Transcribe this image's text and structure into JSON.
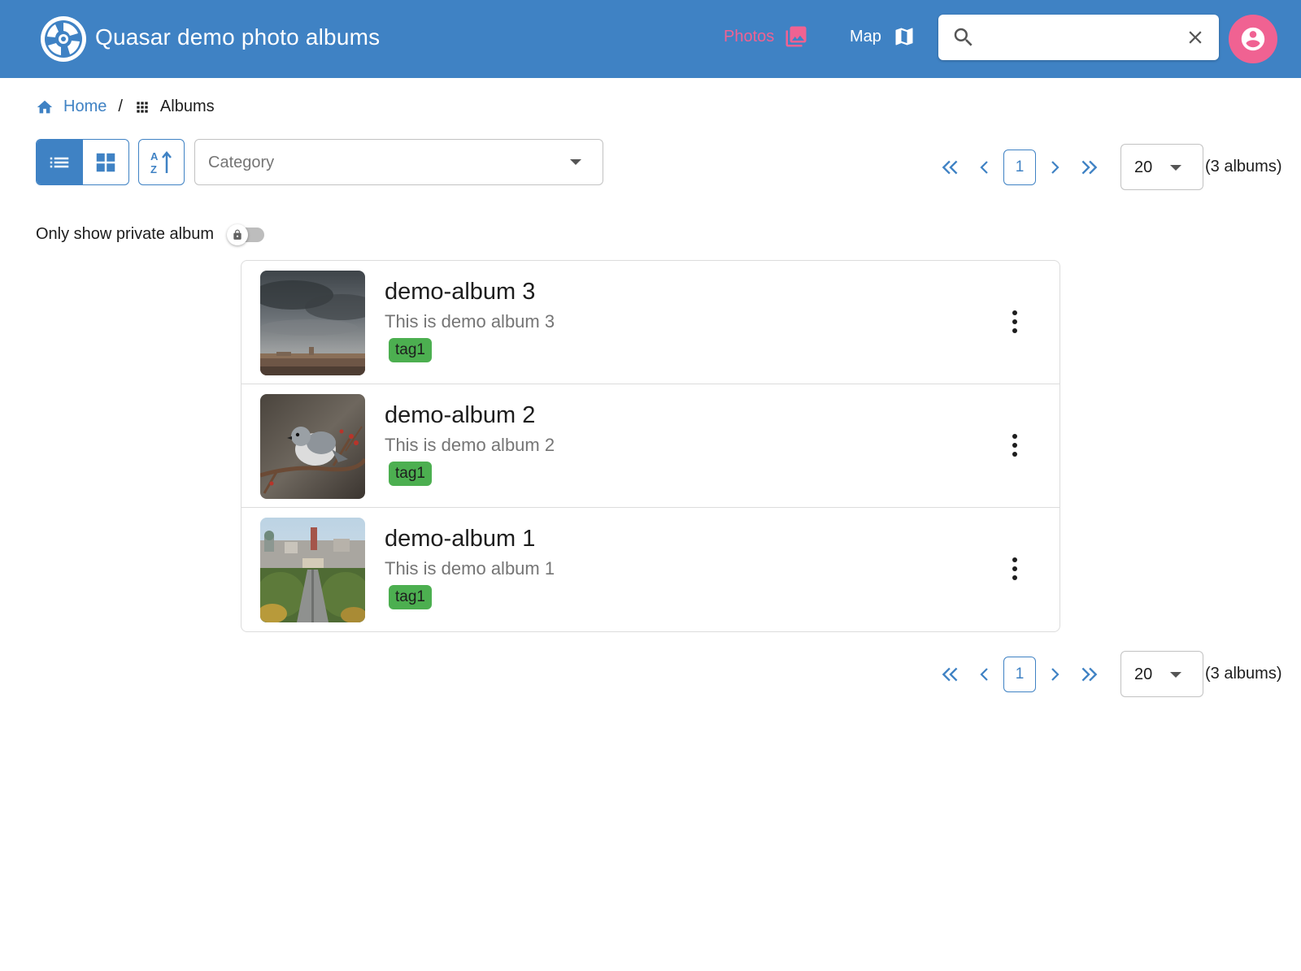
{
  "header": {
    "title": "Quasar demo photo albums",
    "nav": {
      "photos_label": "Photos",
      "map_label": "Map"
    },
    "search": {
      "value": "",
      "placeholder": ""
    },
    "colors": {
      "bar": "#3f82c4",
      "accent": "#f06292"
    }
  },
  "breadcrumb": {
    "home": "Home",
    "separator": "/",
    "current": "Albums"
  },
  "toolbar": {
    "view_modes": [
      "list",
      "grid"
    ],
    "active_view": "list",
    "category_placeholder": "Category"
  },
  "pagination": {
    "current_page": "1",
    "per_page": "20",
    "count_text": "(3 albums)"
  },
  "filters": {
    "private_label": "Only show private album",
    "private_enabled": false
  },
  "albums": [
    {
      "title": "demo-album 3",
      "description": "This is demo album 3",
      "tag": "tag1",
      "thumbnail": "stormy-sky-landscape"
    },
    {
      "title": "demo-album 2",
      "description": "This is demo album 2",
      "tag": "tag1",
      "thumbnail": "titmouse-bird-on-branch"
    },
    {
      "title": "demo-album 1",
      "description": "This is demo album 1",
      "tag": "tag1",
      "thumbnail": "city-aerial-view"
    }
  ]
}
